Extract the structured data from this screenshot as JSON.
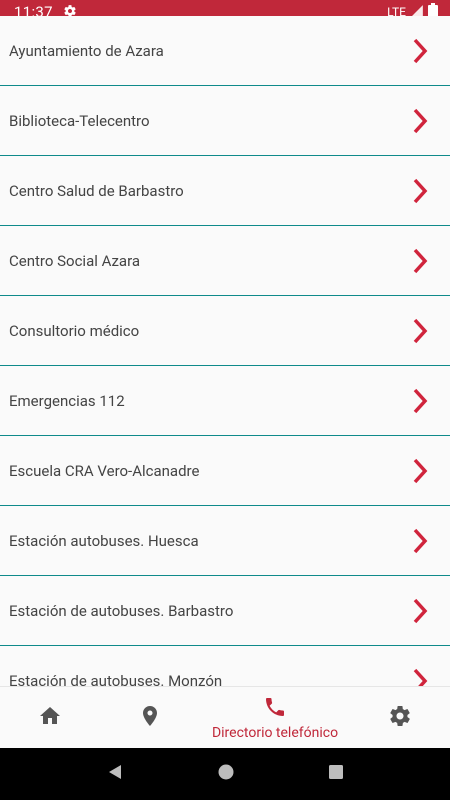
{
  "status_bar": {
    "time": "11:37",
    "network": "LTE",
    "background_color": "#c0283a",
    "icons": [
      "settings-gear-icon",
      "signal-icon",
      "battery-icon"
    ]
  },
  "directory": {
    "items": [
      {
        "label": "Ayuntamiento de Azara"
      },
      {
        "label": "Biblioteca-Telecentro"
      },
      {
        "label": "Centro Salud de Barbastro"
      },
      {
        "label": "Centro Social Azara"
      },
      {
        "label": "Consultorio médico"
      },
      {
        "label": "Emergencias 112"
      },
      {
        "label": "Escuela CRA Vero-Alcanadre"
      },
      {
        "label": "Estación autobuses. Huesca"
      },
      {
        "label": "Estación de autobuses. Barbastro"
      },
      {
        "label": "Estación de autobuses. Monzón"
      }
    ],
    "chevron_icon": "chevron-right-icon",
    "accent_color": "#d0243c",
    "divider_color": "#0e8a8a"
  },
  "bottom_nav": {
    "items": [
      {
        "icon": "home-icon",
        "label": ""
      },
      {
        "icon": "map-pin-icon",
        "label": ""
      },
      {
        "icon": "phone-icon",
        "label": "Directorio telefónico"
      },
      {
        "icon": "settings-icon",
        "label": ""
      }
    ],
    "active_color": "#c0283a",
    "inactive_color": "#555555"
  },
  "system_nav": {
    "icons": [
      "back-icon",
      "home-circle-icon",
      "recents-icon"
    ]
  }
}
